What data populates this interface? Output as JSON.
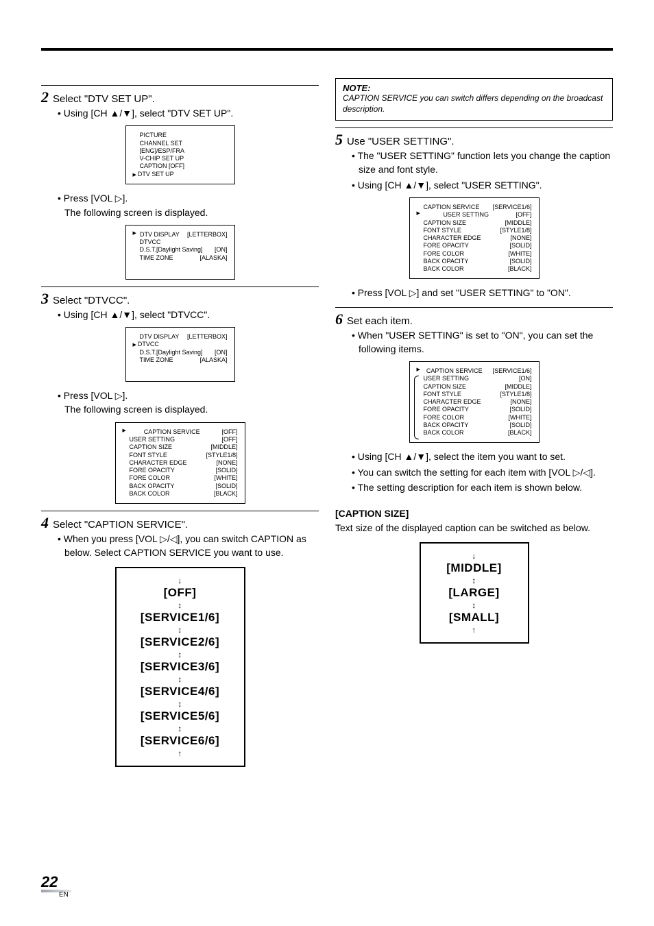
{
  "page_number": "22",
  "page_lang": "EN",
  "left": {
    "step2": {
      "title": "Select \"DTV SET UP\".",
      "b1": "Using [CH ▲/▼], select \"DTV SET UP\".",
      "menu1": {
        "r1": "PICTURE",
        "r2": "CHANNEL SET",
        "r3": "[ENG]/ESP/FRA",
        "r4": "V-CHIP SET UP",
        "r5": "CAPTION [OFF]",
        "r6": "DTV SET UP"
      },
      "b2": "Press [VOL ▷].",
      "b2_after": "The following screen is displayed.",
      "menu2": {
        "r1k": "DTV DISPLAY",
        "r1v": "[LETTERBOX]",
        "r2": "DTVCC",
        "r3k": "D.S.T.[Daylight Saving]",
        "r3v": "[ON]",
        "r4k": "TIME ZONE",
        "r4v": "[ALASKA]"
      }
    },
    "step3": {
      "title": "Select \"DTVCC\".",
      "b1": "Using [CH ▲/▼], select \"DTVCC\".",
      "menu1": {
        "r1k": "DTV DISPLAY",
        "r1v": "[LETTERBOX]",
        "r2": "DTVCC",
        "r3k": "D.S.T.[Daylight Saving]",
        "r3v": "[ON]",
        "r4k": "TIME ZONE",
        "r4v": "[ALASKA]"
      },
      "b2": "Press [VOL ▷].",
      "b2_after": "The following screen is displayed.",
      "menu2": {
        "r1k": "CAPTION SERVICE",
        "r1v": "[OFF]",
        "r2k": "USER SETTING",
        "r2v": "[OFF]",
        "r3k": "CAPTION SIZE",
        "r3v": "[MIDDLE]",
        "r4k": "FONT STYLE",
        "r4v": "[STYLE1/8]",
        "r5k": "CHARACTER EDGE",
        "r5v": "[NONE]",
        "r6k": "FORE OPACITY",
        "r6v": "[SOLID]",
        "r7k": "FORE COLOR",
        "r7v": "[WHITE]",
        "r8k": "BACK OPACITY",
        "r8v": "[SOLID]",
        "r9k": "BACK COLOR",
        "r9v": "[BLACK]"
      }
    },
    "step4": {
      "title": "Select \"CAPTION SERVICE\".",
      "b1": "When you press [VOL ▷/◁], you can switch CAPTION as below. Select CAPTION SERVICE you want to use.",
      "cycle": [
        "[OFF]",
        "[SERVICE1/6]",
        "[SERVICE2/6]",
        "[SERVICE3/6]",
        "[SERVICE4/6]",
        "[SERVICE5/6]",
        "[SERVICE6/6]"
      ]
    }
  },
  "right": {
    "note": {
      "title": "NOTE:",
      "body": "CAPTION SERVICE you can switch differs depending on the broadcast description."
    },
    "step5": {
      "title": "Use \"USER SETTING\".",
      "b1": "The \"USER SETTING\" function lets you change the caption size and font style.",
      "b2": "Using [CH ▲/▼], select \"USER SETTING\".",
      "menu": {
        "r1k": "CAPTION SERVICE",
        "r1v": "[SERVICE1/6]",
        "r2k": "USER SETTING",
        "r2v": "[OFF]",
        "r3k": "CAPTION SIZE",
        "r3v": "[MIDDLE]",
        "r4k": "FONT STYLE",
        "r4v": "[STYLE1/8]",
        "r5k": "CHARACTER EDGE",
        "r5v": "[NONE]",
        "r6k": "FORE OPACITY",
        "r6v": "[SOLID]",
        "r7k": "FORE COLOR",
        "r7v": "[WHITE]",
        "r8k": "BACK OPACITY",
        "r8v": "[SOLID]",
        "r9k": "BACK COLOR",
        "r9v": "[BLACK]"
      },
      "b3": "Press [VOL ▷] and set \"USER SETTING\" to \"ON\"."
    },
    "step6": {
      "title": "Set each item.",
      "b1": "When \"USER SETTING\" is set to \"ON\", you can set the following items.",
      "menu": {
        "r1k": "CAPTION SERVICE",
        "r1v": "[SERVICE1/6]",
        "r2k": "USER SETTING",
        "r2v": "[ON]",
        "r3k": "CAPTION SIZE",
        "r3v": "[MIDDLE]",
        "r4k": "FONT STYLE",
        "r4v": "[STYLE1/8]",
        "r5k": "CHARACTER EDGE",
        "r5v": "[NONE]",
        "r6k": "FORE OPACITY",
        "r6v": "[SOLID]",
        "r7k": "FORE COLOR",
        "r7v": "[WHITE]",
        "r8k": "BACK OPACITY",
        "r8v": "[SOLID]",
        "r9k": "BACK COLOR",
        "r9v": "[BLACK]"
      },
      "b2": "Using [CH ▲/▼], select the item you want to set.",
      "b3": "You can switch the setting for each item with [VOL ▷/◁].",
      "b4": "The setting description for each item is shown below."
    },
    "caption_size": {
      "head": "[CAPTION SIZE]",
      "para": "Text size of the displayed caption can be switched as below.",
      "cycle": [
        "[MIDDLE]",
        "[LARGE]",
        "[SMALL]"
      ]
    }
  }
}
